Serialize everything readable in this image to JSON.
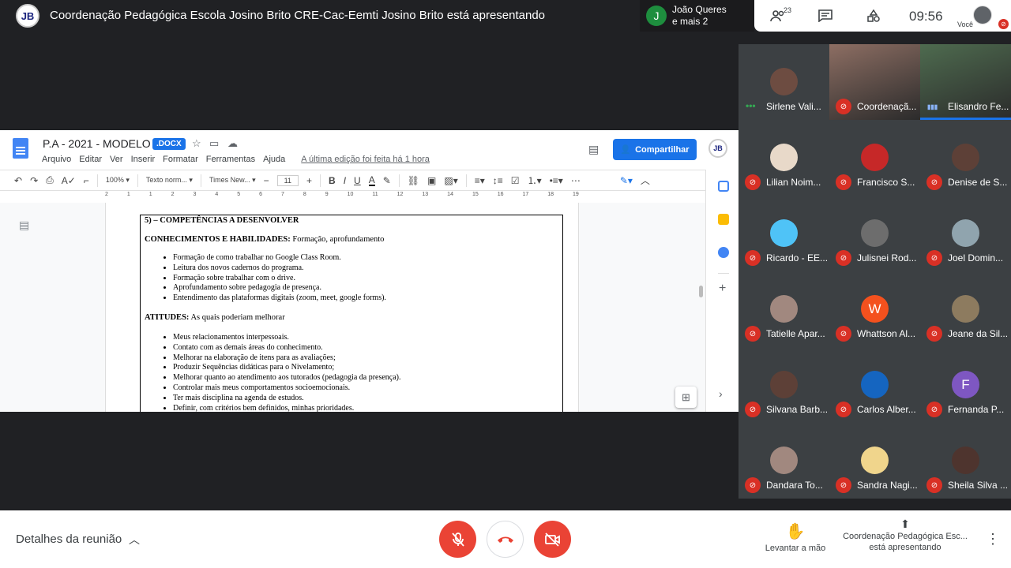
{
  "top": {
    "presenter_logo": "JB",
    "presenter_title": "Coordenação Pedagógica Escola Josino Brito CRE-Cac-Eemti Josino Brito está apresentando",
    "joined_initial": "J",
    "joined_line1": "João Queres",
    "joined_line2": "e mais 2",
    "people_count": "23",
    "clock": "09:56",
    "self_label": "Você"
  },
  "doc": {
    "title": "P.A - 2021 - MODELO",
    "badge": ".DOCX",
    "menu": [
      "Arquivo",
      "Editar",
      "Ver",
      "Inserir",
      "Formatar",
      "Ferramentas",
      "Ajuda"
    ],
    "last_edit": "A última edição foi feita há 1 hora",
    "share": "Compartilhar",
    "avatar": "JB",
    "toolbar": {
      "zoom": "100%",
      "style": "Texto norm...",
      "font": "Times New...",
      "size": "11"
    },
    "ruler": [
      "2",
      "1",
      "1",
      "2",
      "3",
      "4",
      "5",
      "6",
      "7",
      "8",
      "9",
      "10",
      "11",
      "12",
      "13",
      "14",
      "15",
      "16",
      "17",
      "18",
      "19"
    ],
    "section_title": "5) – COMPETÊNCIAS A DESENVOLVER",
    "knowledge_label": "CONHECIMENTOS E HABILIDADES:",
    "knowledge_text": " Formação, aprofundamento",
    "knowledge_items": [
      "Formação de como trabalhar no Google Class Room.",
      "Leitura dos novos cadernos do programa.",
      "Formação sobre trabalhar com o drive.",
      "Aprofundamento sobre pedagogia de presença.",
      "Entendimento das plataformas digitais (zoom, meet, google forms)."
    ],
    "attitudes_label": "ATITUDES:",
    "attitudes_text": " As quais poderiam melhorar",
    "attitudes_items": [
      "Meus relacionamentos interpessoais.",
      "Contato com as demais áreas do conhecimento.",
      "Melhorar na elaboração de itens para as avaliações;",
      "Produzir Sequências didáticas para o Nivelamento;",
      "Melhorar quanto ao atendimento aos tutorados (pedagogia da presença).",
      "Controlar mais meus comportamentos socioemocionais.",
      "Ter mais disciplina na agenda de estudos.",
      "Definir, com critérios bem definidos, minhas prioridades."
    ]
  },
  "participants": [
    {
      "name": "Sirlene Vali...",
      "color": "#6d4c41",
      "mic": "speaking"
    },
    {
      "name": "Coordenaçã...",
      "color": "#8d6e63",
      "mic": "muted",
      "video": true
    },
    {
      "name": "Elisandro Fe...",
      "color": "#4e6b4f",
      "mic": "active",
      "video": true
    },
    {
      "name": "Lilian Noim...",
      "color": "#e8d9c9",
      "mic": "muted"
    },
    {
      "name": "Francisco S...",
      "color": "#c62828",
      "mic": "muted"
    },
    {
      "name": "Denise de S...",
      "color": "#5d4037",
      "mic": "muted"
    },
    {
      "name": "Ricardo - EE...",
      "color": "#4fc3f7",
      "mic": "muted"
    },
    {
      "name": "Julisnei Rod...",
      "color": "#6d6d6d",
      "mic": "muted"
    },
    {
      "name": "Joel Domin...",
      "color": "#90a4ae",
      "mic": "muted"
    },
    {
      "name": "Tatielle Apar...",
      "color": "#a1887f",
      "mic": "muted"
    },
    {
      "name": "Whattson Al...",
      "color": "#f4511e",
      "initial": "W",
      "mic": "muted"
    },
    {
      "name": "Jeane da Sil...",
      "color": "#8d7b5f",
      "mic": "muted"
    },
    {
      "name": "Silvana Barb...",
      "color": "#5d4037",
      "mic": "muted"
    },
    {
      "name": "Carlos Alber...",
      "color": "#1565c0",
      "mic": "muted"
    },
    {
      "name": "Fernanda P...",
      "color": "#7e57c2",
      "initial": "F",
      "mic": "muted"
    },
    {
      "name": "Dandara To...",
      "color": "#a1887f",
      "mic": "muted"
    },
    {
      "name": "Sandra Nagi...",
      "color": "#f0d58c",
      "mic": "muted"
    },
    {
      "name": "Sheila Silva ...",
      "color": "#4e342e",
      "mic": "muted"
    }
  ],
  "bottom": {
    "details": "Detalhes da reunião",
    "raise_hand": "Levantar a mão",
    "presenting_line1": "Coordenação Pedagógica Esc...",
    "presenting_line2": "está apresentando"
  },
  "colors": {
    "danger": "#ea4335",
    "accent": "#1a73e8"
  }
}
